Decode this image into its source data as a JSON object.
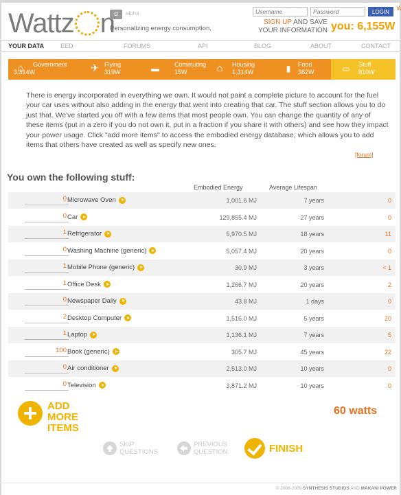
{
  "header": {
    "logo_left": "Wattz",
    "logo_right": "n",
    "alpha_badge": "α",
    "alpha_label": "alpha",
    "tagline": "Personalizing energy consumption.",
    "login": {
      "username_placeholder": "Username",
      "password_placeholder": "Password",
      "login_button": "LOGIN"
    },
    "signup": {
      "link": "SIGN UP",
      "rest1": " AND SAVE",
      "line2": "YOUR INFORMATION"
    },
    "you_total": "you: 6,155W"
  },
  "nav": {
    "items": [
      "YOUR DATA",
      "EED",
      "FORUMS",
      "API",
      "BLOG",
      "ABOUT",
      "CONTACT"
    ],
    "active": "YOUR DATA"
  },
  "categories": [
    {
      "label": "Government",
      "watts": "3,314W",
      "icon": "capitol-icon"
    },
    {
      "label": "Flying",
      "watts": "319W",
      "icon": "airplane-icon"
    },
    {
      "label": "Commuting",
      "watts": "15W",
      "icon": "car-icon"
    },
    {
      "label": "Housing",
      "watts": "1,314W",
      "icon": "house-icon"
    },
    {
      "label": "Food",
      "watts": "382W",
      "icon": "bottle-icon"
    },
    {
      "label": "Stuff",
      "watts": "810W",
      "icon": "chair-icon",
      "selected": true
    }
  ],
  "intro": {
    "text": "There is energy incorporated in everything we own. It would not paint a complete picture to account for the fuel your car uses without also adding in the energy that went into creating that car. The stuff section allows you to do just that. We've started you off with a few items that most people own. You can change the quantity of any of these items (put in a zero if you do not own it, put in a fraction if you share it with others) and see how they impact your power usage. Click \"add more items\" to access the embodied energy database, which allows you to add items that others have created as well as specify new ones.",
    "forum_link": "[forum]"
  },
  "stuff": {
    "heading": "You own the following stuff:",
    "columns": {
      "embodied": "Embodied Energy",
      "lifespan": "Average Lifespan",
      "watts": "Watts"
    },
    "rows": [
      {
        "qty": "0",
        "name": "Microwave Oven",
        "energy": "1,001.6 MJ",
        "lifespan": "7 years",
        "watts": "0"
      },
      {
        "qty": "0",
        "name": "Car",
        "energy": "129,855.4 MJ",
        "lifespan": "27 years",
        "watts": "0"
      },
      {
        "qty": "1",
        "name": "Refrigerator",
        "energy": "5,970.5 MJ",
        "lifespan": "18 years",
        "watts": "11"
      },
      {
        "qty": "0",
        "name": "Washing Machine (generic)",
        "energy": "5,057.4 MJ",
        "lifespan": "20 years",
        "watts": "0"
      },
      {
        "qty": "1",
        "name": "Mobile Phone (generic)",
        "energy": "30.9 MJ",
        "lifespan": "3 years",
        "watts": "< 1"
      },
      {
        "qty": "1",
        "name": "Office Desk",
        "energy": "1,266.7 MJ",
        "lifespan": "20 years",
        "watts": "2"
      },
      {
        "qty": "0",
        "name": "Newspaper Daily",
        "energy": "43.8 MJ",
        "lifespan": "1 days",
        "watts": "0"
      },
      {
        "qty": "2",
        "name": "Desktop Computer",
        "energy": "1,516.0 MJ",
        "lifespan": "5 years",
        "watts": "20"
      },
      {
        "qty": "1",
        "name": "Laptop",
        "energy": "1,136.1 MJ",
        "lifespan": "7 years",
        "watts": "5"
      },
      {
        "qty": "100",
        "name": "Book (generic)",
        "energy": "305.7 MJ",
        "lifespan": "45 years",
        "watts": "22"
      },
      {
        "qty": "0",
        "name": "Air conditioner",
        "energy": "2,513.0 MJ",
        "lifespan": "10 years",
        "watts": "0"
      },
      {
        "qty": "0",
        "name": "Television",
        "energy": "3,871.2 MJ",
        "lifespan": "10 years",
        "watts": "0"
      }
    ],
    "add_more": "ADD MORE ITEMS",
    "total": "60 watts"
  },
  "footer_nav": {
    "skip": "SKIP QUESTIONS",
    "previous": "PREVIOUS QUESTION",
    "finish": "FINISH"
  },
  "copyright": {
    "prefix": "© 2008-2009 ",
    "studio1": "SYNTHESIS STUDIOS",
    "and": " AND ",
    "studio2": "MAKANI POWER"
  },
  "colors": {
    "orange": "#ee9022",
    "yellow": "#f4c227",
    "accent": "#e8701a",
    "login_blue": "#3c5fb0"
  }
}
